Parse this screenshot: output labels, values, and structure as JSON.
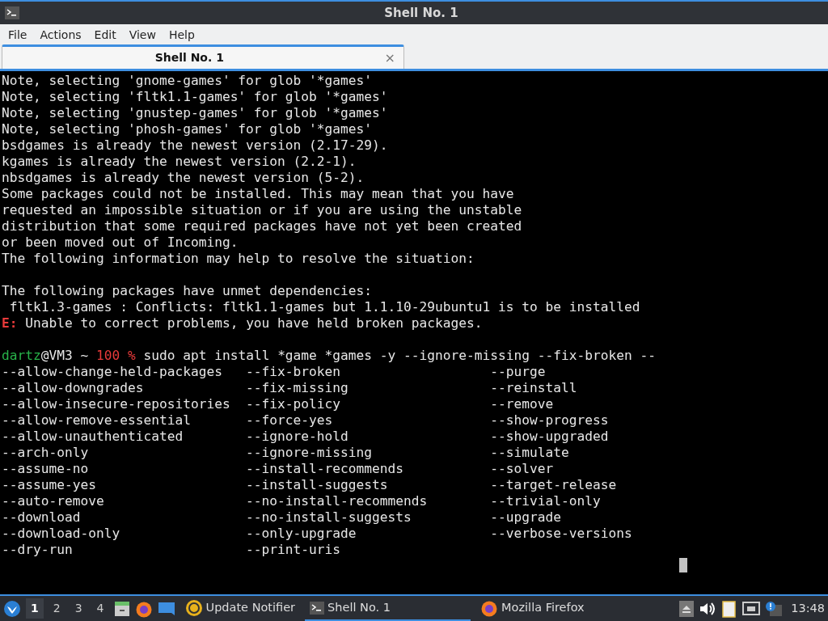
{
  "window": {
    "title": "Shell No. 1"
  },
  "menu": [
    "File",
    "Actions",
    "Edit",
    "View",
    "Help"
  ],
  "tabs": [
    {
      "label": "Shell No. 1",
      "close": "×",
      "selected": true
    }
  ],
  "terminal": {
    "lines": [
      {
        "kind": "text",
        "text": "Note, selecting 'gnome-games' for glob '*games'"
      },
      {
        "kind": "text",
        "text": "Note, selecting 'fltk1.1-games' for glob '*games'"
      },
      {
        "kind": "text",
        "text": "Note, selecting 'gnustep-games' for glob '*games'"
      },
      {
        "kind": "text",
        "text": "Note, selecting 'phosh-games' for glob '*games'"
      },
      {
        "kind": "text",
        "text": "bsdgames is already the newest version (2.17-29)."
      },
      {
        "kind": "text",
        "text": "kgames is already the newest version (2.2-1)."
      },
      {
        "kind": "text",
        "text": "nbsdgames is already the newest version (5-2)."
      },
      {
        "kind": "text",
        "text": "Some packages could not be installed. This may mean that you have"
      },
      {
        "kind": "text",
        "text": "requested an impossible situation or if you are using the unstable"
      },
      {
        "kind": "text",
        "text": "distribution that some required packages have not yet been created"
      },
      {
        "kind": "text",
        "text": "or been moved out of Incoming."
      },
      {
        "kind": "text",
        "text": "The following information may help to resolve the situation:"
      },
      {
        "kind": "blank"
      },
      {
        "kind": "text",
        "text": "The following packages have unmet dependencies:"
      },
      {
        "kind": "text",
        "text": " fltk1.3-games : Conflicts: fltk1.1-games but 1.1.10-29ubuntu1 is to be installed"
      },
      {
        "kind": "error",
        "tag": "E:",
        "text": " Unable to correct problems, you have held broken packages."
      },
      {
        "kind": "blank"
      },
      {
        "kind": "prompt",
        "user": "dartz",
        "host": "@VM3 ~ ",
        "status": "100 %",
        "command": " sudo apt install *game *games -y --ignore-missing --fix-broken --"
      }
    ],
    "completions": [
      [
        "--allow-change-held-packages",
        "--fix-broken",
        "--purge"
      ],
      [
        "--allow-downgrades",
        "--fix-missing",
        "--reinstall"
      ],
      [
        "--allow-insecure-repositories",
        "--fix-policy",
        "--remove"
      ],
      [
        "--allow-remove-essential",
        "--force-yes",
        "--show-progress"
      ],
      [
        "--allow-unauthenticated",
        "--ignore-hold",
        "--show-upgraded"
      ],
      [
        "--arch-only",
        "--ignore-missing",
        "--simulate"
      ],
      [
        "--assume-no",
        "--install-recommends",
        "--solver"
      ],
      [
        "--assume-yes",
        "--install-suggests",
        "--target-release"
      ],
      [
        "--auto-remove",
        "--no-install-recommends",
        "--trivial-only"
      ],
      [
        "--download",
        "--no-install-suggests",
        "--upgrade"
      ],
      [
        "--download-only",
        "--only-upgrade",
        "--verbose-versions"
      ],
      [
        "--dry-run",
        "--print-uris"
      ]
    ]
  },
  "taskbar": {
    "workspaces": [
      {
        "label": "1",
        "selected": true
      },
      {
        "label": "2",
        "selected": false
      },
      {
        "label": "3",
        "selected": false
      },
      {
        "label": "4",
        "selected": false
      }
    ],
    "tasks": [
      {
        "kind": "notifier",
        "label": "Update Notifier",
        "selected": false
      },
      {
        "kind": "terminal",
        "label": "Shell No. 1",
        "selected": true
      },
      {
        "kind": "firefox",
        "label": "Mozilla Firefox",
        "selected": false
      }
    ],
    "clock": "13:48"
  }
}
